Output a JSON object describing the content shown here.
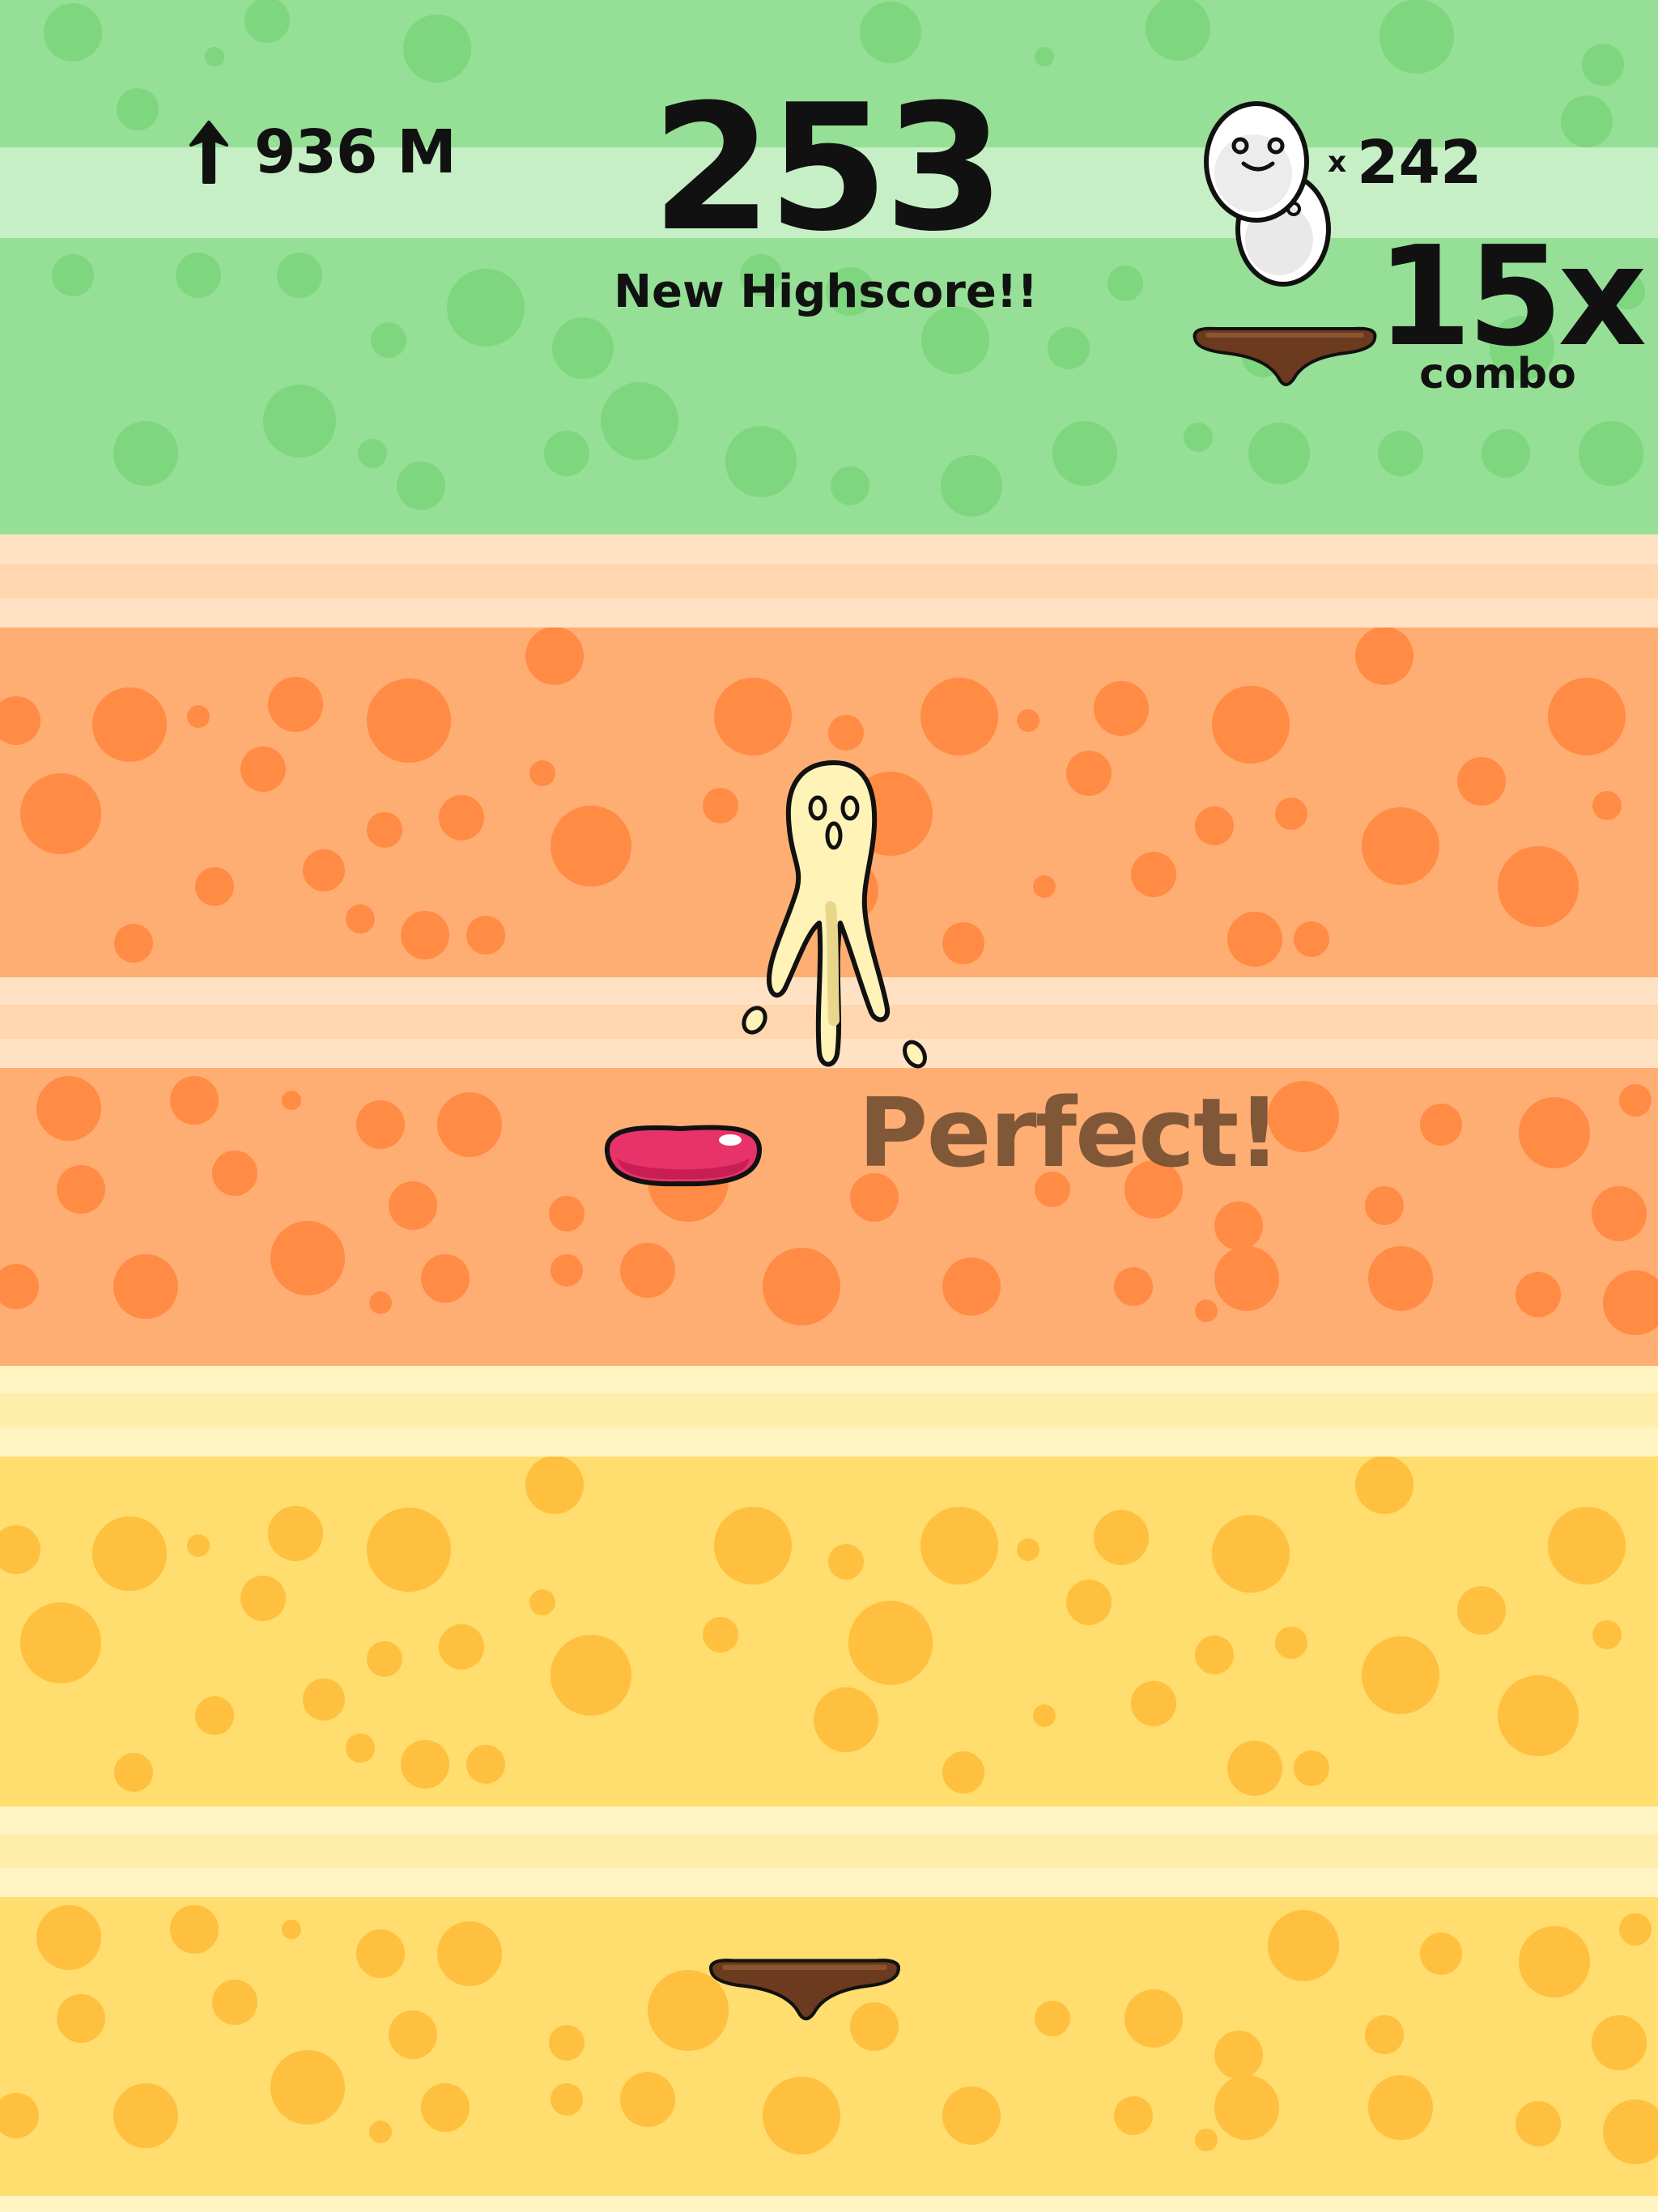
{
  "hud": {
    "distance": "936 M",
    "score": "253",
    "highscore_label": "New Highscore!!",
    "eggs_prefix": "x",
    "eggs_count": "242",
    "combo_multiplier": "15x",
    "combo_label": "combo"
  },
  "feedback": {
    "label": "Perfect!"
  },
  "icons": {
    "distance": "up-arrow-icon",
    "eggs": "egg-buddies-icon",
    "player": "slime-player",
    "platforms": [
      "brown-ledge-platform",
      "red-jelly-bean-platform"
    ]
  },
  "colors": {
    "green_band": "#96df96",
    "green_spot": "#7ed67e",
    "orange_band": "#ffae73",
    "orange_spot": "#ff8b45",
    "yellow_band": "#ffdd6e",
    "yellow_spot": "#ffbf3f",
    "ledge": "#6b3a1f",
    "jelly": "#e8336a"
  }
}
